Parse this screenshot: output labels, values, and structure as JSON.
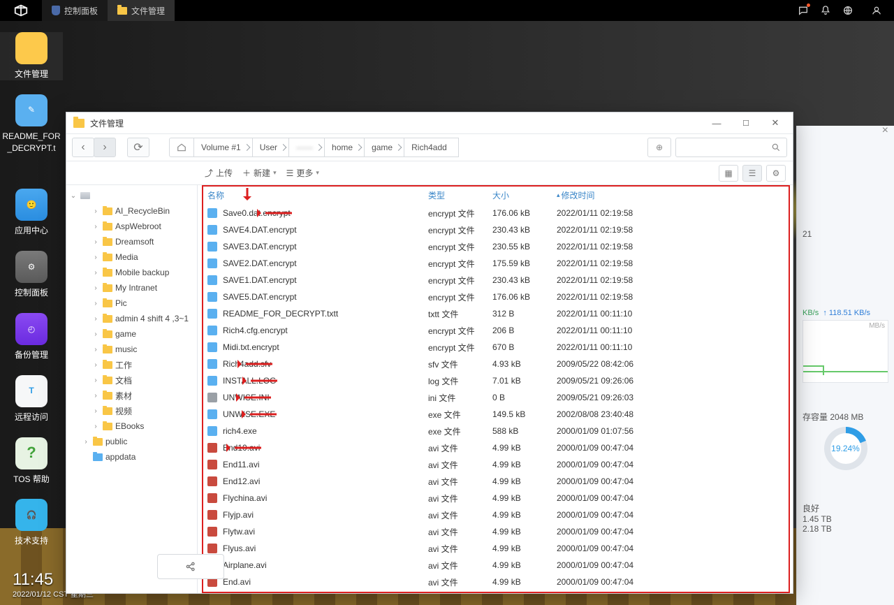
{
  "topbar": {
    "tabs": [
      {
        "label": "控制面板"
      },
      {
        "label": "文件管理"
      }
    ]
  },
  "dock": {
    "items": [
      {
        "label": "文件管理"
      },
      {
        "label": "README_FOR_DECRYPT.t"
      },
      {
        "label": "应用中心"
      },
      {
        "label": "控制面板"
      },
      {
        "label": "备份管理"
      },
      {
        "label": "远程访问"
      },
      {
        "label": "TOS 帮助"
      },
      {
        "label": "技术支持"
      }
    ]
  },
  "clock": {
    "time": "11:45",
    "date": "2022/01/12 CST 星期三"
  },
  "right_panel": {
    "line1_suffix": "21",
    "dn_label": "KB/s",
    "up_value": "118.51 KB/s",
    "chart_unit": "MB/s",
    "cache_label": "存容量 2048 MB",
    "donut_pct": "19.24%",
    "status": "良好",
    "val1": "1.45 TB",
    "val2": "2.18 TB"
  },
  "fm": {
    "title": "文件管理",
    "breadcrumb": [
      "Volume #1",
      "User",
      "",
      "home",
      "game",
      "Rich4add"
    ],
    "actions": {
      "upload": "上传",
      "new": "新建",
      "more": "更多"
    },
    "columns": {
      "name": "名称",
      "type": "类型",
      "size": "大小",
      "mtime": "修改时间"
    },
    "tree": [
      {
        "label": "AI_RecycleBin",
        "depth": 2
      },
      {
        "label": "AspWebroot",
        "depth": 2
      },
      {
        "label": "Dreamsoft",
        "depth": 2
      },
      {
        "label": "Media",
        "depth": 2
      },
      {
        "label": "Mobile backup",
        "depth": 2
      },
      {
        "label": "My Intranet",
        "depth": 2
      },
      {
        "label": "Pic",
        "depth": 2
      },
      {
        "label": "admin 4 shift 4 ,3~1",
        "depth": 2
      },
      {
        "label": "game",
        "depth": 2
      },
      {
        "label": "music",
        "depth": 2
      },
      {
        "label": "工作",
        "depth": 2
      },
      {
        "label": "文档",
        "depth": 2
      },
      {
        "label": "素材",
        "depth": 2
      },
      {
        "label": "视频",
        "depth": 2
      },
      {
        "label": "EBooks",
        "depth": 2
      },
      {
        "label": "public",
        "depth": 1,
        "tw": "›"
      },
      {
        "label": "appdata",
        "depth": 1,
        "tw": "",
        "blue": true
      }
    ],
    "files": [
      {
        "n": "Save0.dat.encrypt",
        "t": "encrypt 文件",
        "s": "176.06 kB",
        "m": "2022/01/11 02:19:58",
        "ic": "doc",
        "arrow": true,
        "downarrow": true
      },
      {
        "n": "SAVE4.DAT.encrypt",
        "t": "encrypt 文件",
        "s": "230.43 kB",
        "m": "2022/01/11 02:19:58",
        "ic": "doc"
      },
      {
        "n": "SAVE3.DAT.encrypt",
        "t": "encrypt 文件",
        "s": "230.55 kB",
        "m": "2022/01/11 02:19:58",
        "ic": "doc"
      },
      {
        "n": "SAVE2.DAT.encrypt",
        "t": "encrypt 文件",
        "s": "175.59 kB",
        "m": "2022/01/11 02:19:58",
        "ic": "doc"
      },
      {
        "n": "SAVE1.DAT.encrypt",
        "t": "encrypt 文件",
        "s": "230.43 kB",
        "m": "2022/01/11 02:19:58",
        "ic": "doc"
      },
      {
        "n": "SAVE5.DAT.encrypt",
        "t": "encrypt 文件",
        "s": "176.06 kB",
        "m": "2022/01/11 02:19:58",
        "ic": "doc"
      },
      {
        "n": "README_FOR_DECRYPT.txtt",
        "t": "txtt 文件",
        "s": "312 B",
        "m": "2022/01/11 00:11:10",
        "ic": "doc"
      },
      {
        "n": "Rich4.cfg.encrypt",
        "t": "encrypt 文件",
        "s": "206 B",
        "m": "2022/01/11 00:11:10",
        "ic": "doc"
      },
      {
        "n": "Midi.txt.encrypt",
        "t": "encrypt 文件",
        "s": "670 B",
        "m": "2022/01/11 00:11:10",
        "ic": "doc"
      },
      {
        "n": "Rich4add.sfv",
        "t": "sfv 文件",
        "s": "4.93 kB",
        "m": "2009/05/22 08:42:06",
        "ic": "doc",
        "arrow": true
      },
      {
        "n": "INSTALL.LOG",
        "t": "log 文件",
        "s": "7.01 kB",
        "m": "2009/05/21 09:26:06",
        "ic": "doc",
        "arrow": true
      },
      {
        "n": "UNWISE.INI",
        "t": "ini 文件",
        "s": "0 B",
        "m": "2009/05/21 09:26:03",
        "ic": "txt",
        "arrow": true
      },
      {
        "n": "UNWISE.EXE",
        "t": "exe 文件",
        "s": "149.5 kB",
        "m": "2002/08/08 23:40:48",
        "ic": "exe",
        "arrow": true
      },
      {
        "n": "rich4.exe",
        "t": "exe 文件",
        "s": "588 kB",
        "m": "2000/01/09 01:07:56",
        "ic": "exe"
      },
      {
        "n": "End10.avi",
        "t": "avi 文件",
        "s": "4.99 kB",
        "m": "2000/01/09 00:47:04",
        "ic": "avi",
        "arrow": true
      },
      {
        "n": "End11.avi",
        "t": "avi 文件",
        "s": "4.99 kB",
        "m": "2000/01/09 00:47:04",
        "ic": "avi"
      },
      {
        "n": "End12.avi",
        "t": "avi 文件",
        "s": "4.99 kB",
        "m": "2000/01/09 00:47:04",
        "ic": "avi"
      },
      {
        "n": "Flychina.avi",
        "t": "avi 文件",
        "s": "4.99 kB",
        "m": "2000/01/09 00:47:04",
        "ic": "avi"
      },
      {
        "n": "Flyjp.avi",
        "t": "avi 文件",
        "s": "4.99 kB",
        "m": "2000/01/09 00:47:04",
        "ic": "avi"
      },
      {
        "n": "Flytw.avi",
        "t": "avi 文件",
        "s": "4.99 kB",
        "m": "2000/01/09 00:47:04",
        "ic": "avi"
      },
      {
        "n": "Flyus.avi",
        "t": "avi 文件",
        "s": "4.99 kB",
        "m": "2000/01/09 00:47:04",
        "ic": "avi"
      },
      {
        "n": "Airplane.avi",
        "t": "avi 文件",
        "s": "4.99 kB",
        "m": "2000/01/09 00:47:04",
        "ic": "avi"
      },
      {
        "n": "End.avi",
        "t": "avi 文件",
        "s": "4.99 kB",
        "m": "2000/01/09 00:47:04",
        "ic": "avi"
      }
    ]
  }
}
